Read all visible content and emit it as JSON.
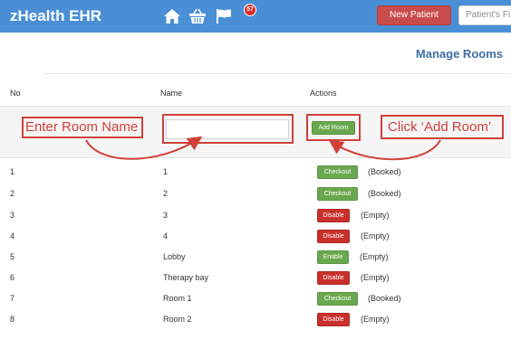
{
  "header": {
    "brand": "zHealth EHR",
    "badge_count": "57",
    "new_patient_label": "New Patient",
    "search_placeholder": "Patient's Fi",
    "icons": [
      "home-icon",
      "basket-icon",
      "flag-icon"
    ],
    "bar_color": "#4a8fd6"
  },
  "page": {
    "title": "Manage Rooms"
  },
  "table": {
    "columns": [
      "No",
      "Name",
      "Actions"
    ],
    "add_room_label": "Add Room",
    "rows": [
      {
        "no": "1",
        "name": "1",
        "action": "Checkout",
        "status": "(Booked)"
      },
      {
        "no": "2",
        "name": "2",
        "action": "Checkout",
        "status": "(Booked)"
      },
      {
        "no": "3",
        "name": "3",
        "action": "Disable",
        "status": "(Empty)"
      },
      {
        "no": "4",
        "name": "4",
        "action": "Disable",
        "status": "(Empty)"
      },
      {
        "no": "5",
        "name": "Lobby",
        "action": "Enable",
        "status": "(Empty)"
      },
      {
        "no": "6",
        "name": "Therapy bay",
        "action": "Disable",
        "status": "(Empty)"
      },
      {
        "no": "7",
        "name": "Room 1",
        "action": "Checkout",
        "status": "(Booked)"
      },
      {
        "no": "8",
        "name": "Room 2",
        "action": "Disable",
        "status": "(Empty)"
      }
    ]
  },
  "annotations": {
    "enter_room_name": "Enter Room Name",
    "click_add_room": "Click ‘Add Room’",
    "color": "#d0413a"
  },
  "colors": {
    "green": "#6aa84f",
    "red": "#c9302c",
    "title": "#3e6ea3"
  }
}
